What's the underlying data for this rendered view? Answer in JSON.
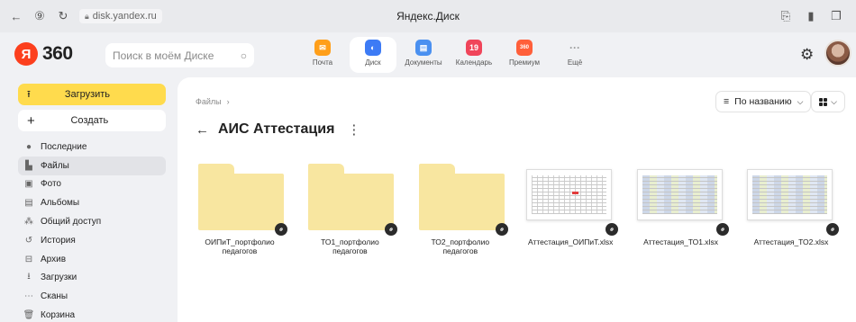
{
  "browser": {
    "url": "disk.yandex.ru",
    "title": "Яндекс.Диск"
  },
  "header": {
    "logo_text": "360",
    "search_placeholder": "Поиск в моём Диске",
    "services": [
      {
        "label": "Почта",
        "icon": "mail-icon"
      },
      {
        "label": "Диск",
        "icon": "disk-icon"
      },
      {
        "label": "Документы",
        "icon": "docs-icon"
      },
      {
        "label": "Календарь",
        "icon": "calendar-icon",
        "badge": "19"
      },
      {
        "label": "Премиум",
        "icon": "premium-icon",
        "badge": "360"
      },
      {
        "label": "Ещё",
        "icon": "more-icon",
        "badge": "···"
      }
    ]
  },
  "sidebar": {
    "upload_label": "Загрузить",
    "create_label": "Создать",
    "items": [
      {
        "label": "Последние",
        "icon": "clock-icon"
      },
      {
        "label": "Файлы",
        "icon": "file-icon",
        "active": true
      },
      {
        "label": "Фото",
        "icon": "photo-icon"
      },
      {
        "label": "Альбомы",
        "icon": "album-icon"
      },
      {
        "label": "Общий доступ",
        "icon": "shared-icon"
      },
      {
        "label": "История",
        "icon": "history-icon"
      },
      {
        "label": "Архив",
        "icon": "archive-icon"
      },
      {
        "label": "Загрузки",
        "icon": "download-icon"
      },
      {
        "label": "Сканы",
        "icon": "scan-icon"
      },
      {
        "label": "Корзина",
        "icon": "trash-icon"
      }
    ]
  },
  "main": {
    "breadcrumb": "Файлы",
    "folder_title": "АИС Аттестация",
    "sort_label": "По названию",
    "files": [
      {
        "name": "ОИПиТ_портфолио педагогов",
        "type": "folder"
      },
      {
        "name": "ТО1_портфолио педагогов",
        "type": "folder"
      },
      {
        "name": "ТО2_портфолио педагогов",
        "type": "folder"
      },
      {
        "name": "Аттестация_ОИПиТ.xlsx",
        "type": "xlsx"
      },
      {
        "name": "Аттестация_ТО1.xlsx",
        "type": "xlsx"
      },
      {
        "name": "Аттестация_ТО2.xlsx",
        "type": "xlsx"
      }
    ]
  }
}
